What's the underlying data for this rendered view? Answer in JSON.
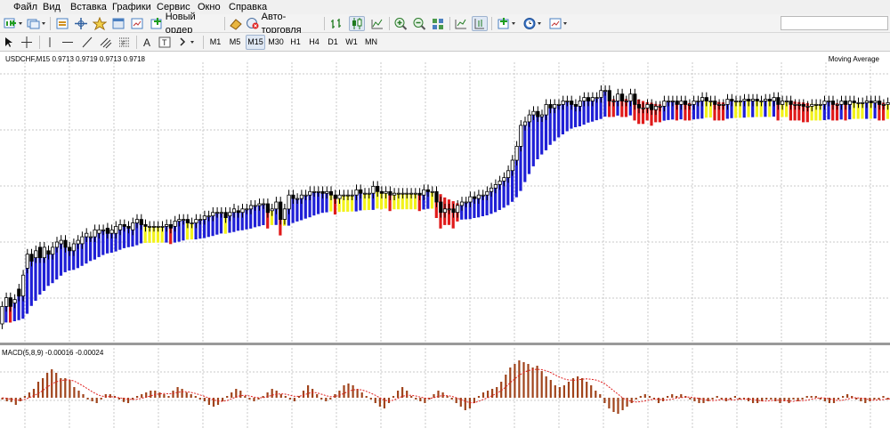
{
  "menu": [
    "Файл",
    "Вид",
    "Вставка",
    "Графики",
    "Сервис",
    "Окно",
    "Справка"
  ],
  "toolbar": {
    "new_order_label": "Новый ордер",
    "auto_trading_label": "Авто-торговля",
    "search_placeholder": ""
  },
  "timeframes": [
    "M1",
    "M5",
    "M15",
    "M30",
    "H1",
    "H4",
    "D1",
    "W1",
    "MN"
  ],
  "active_timeframe": "M15",
  "chart": {
    "header": "USDCHF,M15  0.9713 0.9719 0.9713 0.9718",
    "indicator_label": "Moving Average",
    "macd_label": "MACD(5,8,9) -0.00016 -0.00024"
  },
  "colors": {
    "cloud_up": "#1f1fd6",
    "cloud_down": "#e01a1a",
    "cloud_neutral": "#f2f21a",
    "macd_histogram": "#a0441c",
    "macd_signal": "#e02020",
    "grid": "#c8c8c8"
  },
  "price_series": {
    "open": [
      0.3,
      0.4,
      0.45,
      0.42,
      0.5,
      0.46,
      0.62,
      0.7,
      0.68,
      0.74,
      0.68,
      0.72,
      0.7,
      0.74,
      0.76,
      0.78,
      0.74,
      0.72,
      0.76,
      0.76,
      0.8,
      0.8,
      0.8,
      0.82,
      0.84,
      0.85,
      0.82,
      0.82,
      0.84,
      0.87,
      0.86,
      0.84,
      0.88,
      0.9,
      0.87,
      0.86,
      0.86,
      0.86,
      0.86,
      0.86,
      0.87,
      0.86,
      0.89,
      0.9,
      0.9,
      0.88,
      0.88,
      0.9,
      0.9,
      0.92,
      0.92,
      0.94,
      0.94,
      0.94,
      0.92,
      0.94,
      0.95,
      0.94,
      0.96,
      0.96,
      0.98,
      0.98,
      0.99,
      0.99,
      0.95,
      0.96,
      1.0,
      0.9,
      0.96,
      1.04,
      1.02,
      1.02,
      1.04,
      1.04,
      1.06,
      1.06,
      1.06,
      1.05,
      1.06,
      1.04,
      1.02,
      1.04,
      1.04,
      1.04,
      1.04,
      1.07,
      1.05,
      1.05,
      1.05,
      1.09,
      1.06,
      1.05,
      1.06,
      1.04,
      1.05,
      1.05,
      1.05,
      1.05,
      1.05,
      1.05,
      1.04,
      1.07,
      1.06,
      1.06,
      1.0,
      0.94,
      0.96,
      0.96,
      0.94,
      0.98,
      1.0,
      1.0,
      1.03,
      1.02,
      1.04,
      1.04,
      1.06,
      1.08,
      1.1,
      1.12,
      1.14,
      1.18,
      1.24,
      1.32,
      1.44,
      1.46,
      1.5,
      1.52,
      1.49,
      1.5,
      1.56,
      1.54,
      1.56,
      1.56,
      1.58,
      1.58,
      1.56,
      1.55,
      1.58,
      1.6,
      1.58,
      1.6,
      1.6,
      1.64,
      1.64,
      1.58,
      1.58,
      1.62,
      1.58,
      1.58,
      1.62,
      1.56,
      1.54,
      1.54,
      1.56,
      1.53,
      1.55,
      1.55,
      1.58,
      1.58,
      1.58,
      1.56,
      1.58,
      1.56,
      1.56,
      1.58,
      1.58,
      1.6,
      1.58,
      1.58,
      1.56,
      1.56,
      1.56,
      1.59,
      1.58,
      1.58,
      1.58,
      1.59,
      1.58,
      1.59,
      1.58,
      1.58,
      1.59,
      1.58,
      1.6,
      1.56,
      1.58,
      1.58,
      1.56,
      1.56,
      1.56,
      1.55,
      1.55,
      1.56,
      1.56,
      1.56,
      1.58,
      1.58,
      1.56,
      1.56,
      1.58,
      1.56,
      1.58,
      1.57,
      1.57,
      1.57,
      1.58,
      1.57,
      1.58,
      1.56,
      1.56
    ],
    "close": [
      0.4,
      0.45,
      0.4,
      0.44,
      0.46,
      0.58,
      0.7,
      0.66,
      0.72,
      0.68,
      0.74,
      0.7,
      0.74,
      0.77,
      0.78,
      0.74,
      0.72,
      0.76,
      0.78,
      0.8,
      0.82,
      0.8,
      0.84,
      0.84,
      0.84,
      0.82,
      0.84,
      0.86,
      0.87,
      0.86,
      0.85,
      0.88,
      0.9,
      0.87,
      0.86,
      0.86,
      0.86,
      0.86,
      0.86,
      0.87,
      0.85,
      0.89,
      0.9,
      0.9,
      0.88,
      0.88,
      0.9,
      0.9,
      0.92,
      0.92,
      0.94,
      0.94,
      0.94,
      0.91,
      0.94,
      0.96,
      0.94,
      0.96,
      0.96,
      0.98,
      0.98,
      0.99,
      0.99,
      0.94,
      0.96,
      1.0,
      0.9,
      0.96,
      1.04,
      1.02,
      1.02,
      1.04,
      1.04,
      1.06,
      1.06,
      1.06,
      1.05,
      1.06,
      1.04,
      1.02,
      1.04,
      1.04,
      1.04,
      1.04,
      1.07,
      1.05,
      1.05,
      1.05,
      1.09,
      1.06,
      1.05,
      1.06,
      1.04,
      1.05,
      1.05,
      1.05,
      1.05,
      1.05,
      1.05,
      1.04,
      1.07,
      1.06,
      1.06,
      1.0,
      0.94,
      0.96,
      0.96,
      0.94,
      0.98,
      1.0,
      1.0,
      1.03,
      1.02,
      1.04,
      1.04,
      1.06,
      1.08,
      1.1,
      1.12,
      1.14,
      1.18,
      1.24,
      1.32,
      1.44,
      1.46,
      1.5,
      1.52,
      1.49,
      1.5,
      1.56,
      1.54,
      1.56,
      1.56,
      1.58,
      1.58,
      1.56,
      1.55,
      1.58,
      1.6,
      1.58,
      1.6,
      1.6,
      1.64,
      1.64,
      1.58,
      1.58,
      1.62,
      1.58,
      1.58,
      1.62,
      1.56,
      1.54,
      1.54,
      1.56,
      1.53,
      1.55,
      1.55,
      1.58,
      1.58,
      1.58,
      1.56,
      1.58,
      1.56,
      1.56,
      1.58,
      1.58,
      1.6,
      1.58,
      1.58,
      1.56,
      1.56,
      1.56,
      1.59,
      1.58,
      1.58,
      1.58,
      1.59,
      1.58,
      1.59,
      1.58,
      1.58,
      1.59,
      1.58,
      1.6,
      1.56,
      1.58,
      1.58,
      1.56,
      1.56,
      1.56,
      1.55,
      1.55,
      1.56,
      1.56,
      1.56,
      1.58,
      1.58,
      1.56,
      1.56,
      1.58,
      1.56,
      1.58,
      1.57,
      1.57,
      1.57,
      1.58,
      1.57,
      1.58,
      1.56,
      1.56,
      1.57
    ]
  },
  "macd_series": {
    "histogram": [
      -0.05,
      -0.1,
      -0.12,
      -0.2,
      -0.1,
      0.05,
      0.15,
      0.25,
      0.45,
      0.55,
      0.7,
      0.8,
      0.7,
      0.55,
      0.55,
      0.5,
      0.3,
      0.2,
      0.1,
      -0.05,
      -0.1,
      -0.15,
      -0.05,
      0.1,
      0.1,
      0.05,
      -0.05,
      -0.12,
      -0.15,
      -0.05,
      0.05,
      0.1,
      0.15,
      0.2,
      0.2,
      0.15,
      0.1,
      0.05,
      0.2,
      0.3,
      0.25,
      0.15,
      0.1,
      0.05,
      -0.05,
      -0.1,
      -0.2,
      -0.25,
      -0.2,
      -0.1,
      0.05,
      0.15,
      0.25,
      0.2,
      0.05,
      -0.05,
      -0.1,
      -0.05,
      0.05,
      0.15,
      0.25,
      0.2,
      0.1,
      0.05,
      -0.05,
      -0.1,
      0.05,
      0.2,
      0.35,
      0.25,
      0.1,
      -0.05,
      -0.1,
      -0.05,
      0.1,
      0.2,
      0.35,
      0.4,
      0.35,
      0.25,
      0.15,
      0.05,
      -0.05,
      -0.15,
      -0.25,
      -0.3,
      -0.15,
      0.05,
      0.2,
      0.3,
      0.2,
      0.05,
      -0.05,
      -0.1,
      -0.15,
      -0.05,
      0.1,
      0.2,
      0.15,
      0.05,
      -0.05,
      -0.15,
      -0.25,
      -0.35,
      -0.3,
      -0.15,
      0.05,
      0.15,
      0.2,
      0.25,
      0.3,
      0.45,
      0.65,
      0.85,
      0.95,
      1.05,
      1.0,
      0.95,
      0.85,
      0.9,
      0.75,
      0.6,
      0.5,
      0.35,
      0.3,
      0.35,
      0.45,
      0.55,
      0.6,
      0.55,
      0.45,
      0.35,
      0.2,
      0.1,
      -0.15,
      -0.3,
      -0.4,
      -0.45,
      -0.35,
      -0.25,
      -0.15,
      -0.05,
      0.05,
      0.1,
      0.05,
      -0.05,
      -0.15,
      -0.1,
      0.05,
      0.1,
      0.05,
      0.1,
      0.05,
      -0.05,
      -0.1,
      -0.15,
      -0.15,
      -0.1,
      -0.05,
      0.05,
      -0.05,
      -0.1,
      -0.05,
      0.05,
      -0.05,
      -0.05,
      -0.1,
      -0.15,
      -0.15,
      -0.1,
      -0.05,
      -0.05,
      -0.1,
      -0.15,
      -0.1,
      -0.15,
      -0.05,
      -0.1,
      -0.05,
      0.05,
      0.05,
      0.05,
      -0.05,
      -0.1,
      -0.15,
      -0.15,
      -0.05,
      0.05,
      0.1,
      0.05,
      -0.05,
      -0.1,
      -0.15,
      -0.1,
      -0.05,
      -0.05,
      0.05,
      -0.05
    ],
    "signal": [
      0.0,
      -0.02,
      -0.04,
      -0.06,
      -0.07,
      -0.05,
      0.0,
      0.06,
      0.12,
      0.2,
      0.3,
      0.38,
      0.45,
      0.48,
      0.5,
      0.5,
      0.47,
      0.4,
      0.33,
      0.25,
      0.17,
      0.1,
      0.05,
      0.03,
      0.03,
      0.02,
      0.0,
      -0.02,
      -0.04,
      -0.05,
      -0.04,
      -0.02,
      0.02,
      0.05,
      0.09,
      0.11,
      0.12,
      0.11,
      0.12,
      0.15,
      0.17,
      0.17,
      0.15,
      0.12,
      0.08,
      0.04,
      -0.01,
      -0.06,
      -0.09,
      -0.1,
      -0.08,
      -0.03,
      0.02,
      0.06,
      0.07,
      0.05,
      0.02,
      0.0,
      0.0,
      0.03,
      0.07,
      0.1,
      0.11,
      0.1,
      0.07,
      0.04,
      0.04,
      0.07,
      0.12,
      0.15,
      0.14,
      0.1,
      0.06,
      0.03,
      0.03,
      0.07,
      0.12,
      0.18,
      0.22,
      0.23,
      0.22,
      0.18,
      0.13,
      0.07,
      0.0,
      -0.07,
      -0.09,
      -0.07,
      -0.02,
      0.04,
      0.07,
      0.07,
      0.05,
      0.02,
      -0.01,
      -0.02,
      0.0,
      0.04,
      0.06,
      0.06,
      0.04,
      0.0,
      -0.05,
      -0.1,
      -0.14,
      -0.14,
      -0.1,
      -0.05,
      0.0,
      0.06,
      0.12,
      0.2,
      0.3,
      0.42,
      0.53,
      0.63,
      0.71,
      0.76,
      0.79,
      0.8,
      0.79,
      0.76,
      0.71,
      0.64,
      0.58,
      0.53,
      0.5,
      0.49,
      0.5,
      0.52,
      0.53,
      0.52,
      0.5,
      0.46,
      0.4,
      0.3,
      0.2,
      0.1,
      0.0,
      -0.07,
      -0.1,
      -0.12,
      -0.11,
      -0.09,
      -0.06,
      -0.04,
      -0.04,
      -0.06,
      -0.06,
      -0.04,
      -0.01,
      0.0,
      0.02,
      0.02,
      0.0,
      -0.02,
      -0.05,
      -0.07,
      -0.08,
      -0.07,
      -0.05,
      -0.05,
      -0.06,
      -0.06,
      -0.04,
      -0.04,
      -0.04,
      -0.05,
      -0.07,
      -0.09,
      -0.09,
      -0.08,
      -0.07,
      -0.07,
      -0.08,
      -0.09,
      -0.1,
      -0.08,
      -0.08,
      -0.07,
      -0.04,
      -0.02,
      0.0,
      -0.01,
      -0.03,
      -0.06,
      -0.08,
      -0.07,
      -0.04,
      -0.01,
      0.0,
      -0.01,
      -0.03,
      -0.06,
      -0.07,
      -0.06,
      -0.05,
      -0.03,
      -0.03
    ]
  }
}
